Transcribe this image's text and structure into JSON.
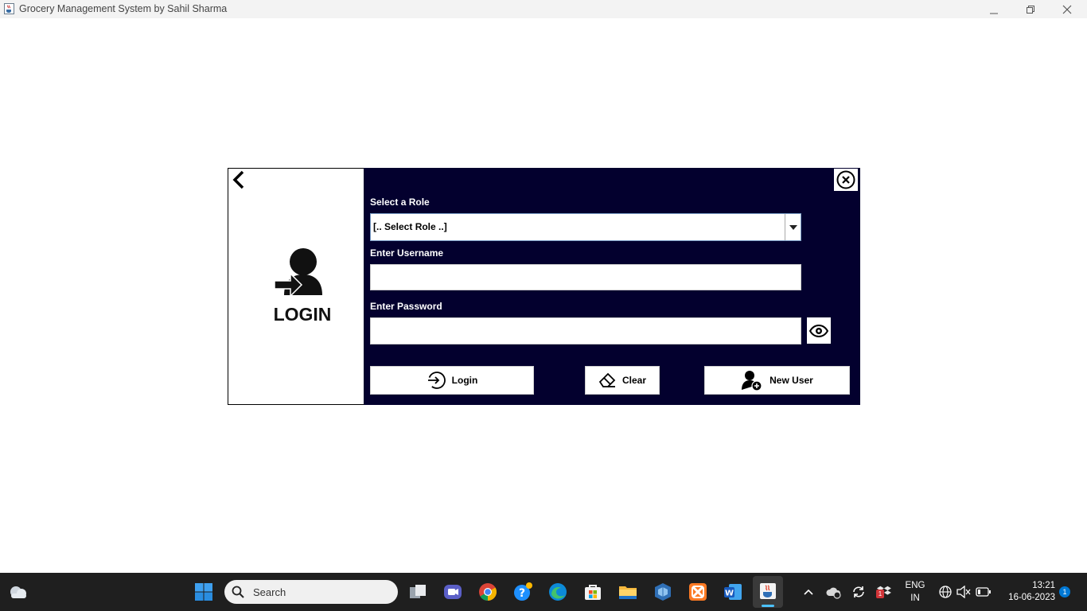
{
  "window": {
    "title": "Grocery Management System by Sahil Sharma"
  },
  "login_panel": {
    "heading": "LOGIN",
    "role_label": "Select a Role",
    "role_selected": "[.. Select Role ..]",
    "username_label": "Enter Username",
    "username_value": "",
    "password_label": "Enter Password",
    "password_value": "",
    "login_button": "Login",
    "clear_button": "Clear",
    "new_user_button": "New User"
  },
  "taskbar": {
    "search_placeholder": "Search",
    "language": "ENG",
    "region": "IN",
    "time": "13:21",
    "date": "16-06-2023",
    "notification_count": "1",
    "tray_badge": "1"
  },
  "colors": {
    "panel_bg": "#03002e",
    "taskbar_bg": "#1f1f1f",
    "accent": "#0078d4"
  }
}
